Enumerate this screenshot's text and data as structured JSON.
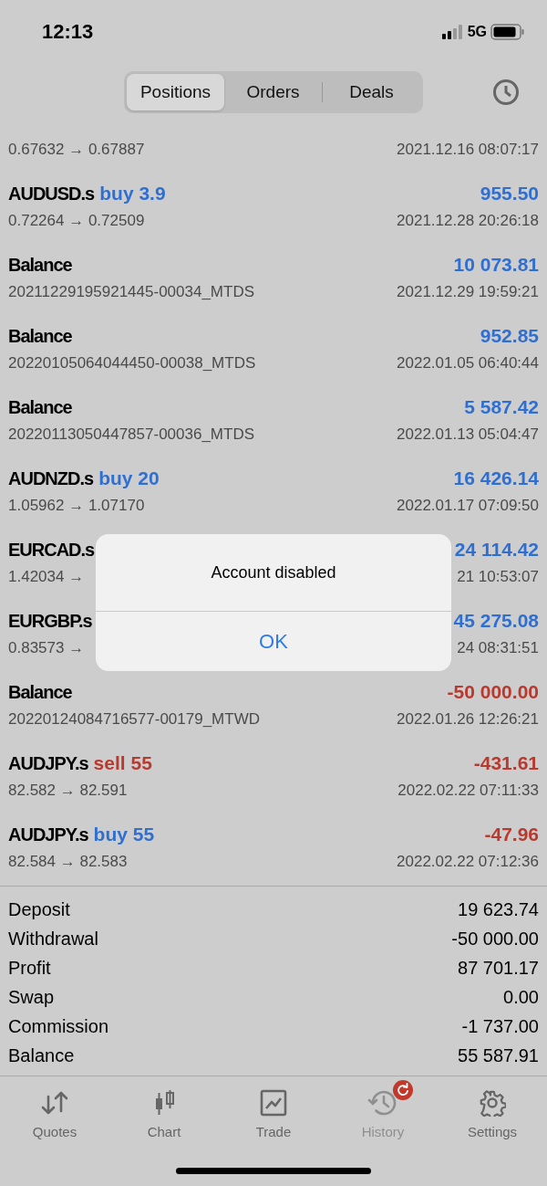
{
  "status_bar": {
    "time": "12:13",
    "network": "5G"
  },
  "segments": [
    {
      "label": "Positions",
      "selected": true
    },
    {
      "label": "Orders",
      "selected": false
    },
    {
      "label": "Deals",
      "selected": false
    }
  ],
  "rows": [
    {
      "prices": "0.67632 → 0.67887",
      "time": "2021.12.16 08:07:17"
    },
    {
      "name": "AUDUSD.s",
      "sell": false,
      "side_text": "buy 3.9",
      "amount": "955.50",
      "loss": false,
      "prices": "0.72264 → 0.72509",
      "time": "2021.12.28 20:26:18"
    },
    {
      "name": "Balance",
      "amount": "10 073.81",
      "loss": false,
      "prices": "20211229195921445-00034_MTDS",
      "time": "2021.12.29 19:59:21"
    },
    {
      "name": "Balance",
      "amount": "952.85",
      "loss": false,
      "prices": "20220105064044450-00038_MTDS",
      "time": "2022.01.05 06:40:44"
    },
    {
      "name": "Balance",
      "amount": "5 587.42",
      "loss": false,
      "prices": "20220113050447857-00036_MTDS",
      "time": "2022.01.13 05:04:47"
    },
    {
      "name": "AUDNZD.s",
      "sell": false,
      "side_text": "buy 20",
      "amount": "16 426.14",
      "loss": false,
      "prices": "1.05962 → 1.07170",
      "time": "2022.01.17 07:09:50"
    },
    {
      "name": "EURCAD.s",
      "amount": "24 114.42",
      "loss": false,
      "prices": "1.42034 →",
      "time": "21 10:53:07"
    },
    {
      "name": "EURGBP.s",
      "amount": "45 275.08",
      "loss": false,
      "prices": "0.83573 →",
      "time": "24 08:31:51"
    },
    {
      "name": "Balance",
      "amount": "-50 000.00",
      "loss": true,
      "prices": "20220124084716577-00179_MTWD",
      "time": "2022.01.26 12:26:21"
    },
    {
      "name": "AUDJPY.s",
      "sell": true,
      "side_text": "sell 55",
      "amount": "-431.61",
      "loss": true,
      "prices": "82.582 → 82.591",
      "time": "2022.02.22 07:11:33"
    },
    {
      "name": "AUDJPY.s",
      "sell": false,
      "side_text": "buy 55",
      "amount": "-47.96",
      "loss": true,
      "prices": "82.584 → 82.583",
      "time": "2022.02.22 07:12:36"
    }
  ],
  "summary": [
    {
      "label": "Deposit",
      "value": "19 623.74"
    },
    {
      "label": "Withdrawal",
      "value": "-50 000.00"
    },
    {
      "label": "Profit",
      "value": "87 701.17"
    },
    {
      "label": "Swap",
      "value": "0.00"
    },
    {
      "label": "Commission",
      "value": "-1 737.00"
    },
    {
      "label": "Balance",
      "value": "55 587.91"
    }
  ],
  "dialog": {
    "message": "Account disabled",
    "button": "OK"
  },
  "tabs": [
    {
      "label": "Quotes",
      "kind": "quotes",
      "selected": false
    },
    {
      "label": "Chart",
      "kind": "chart",
      "selected": false
    },
    {
      "label": "Trade",
      "kind": "trade",
      "selected": false
    },
    {
      "label": "History",
      "kind": "history",
      "selected": true,
      "badge": true
    },
    {
      "label": "Settings",
      "kind": "settings",
      "selected": false
    }
  ]
}
